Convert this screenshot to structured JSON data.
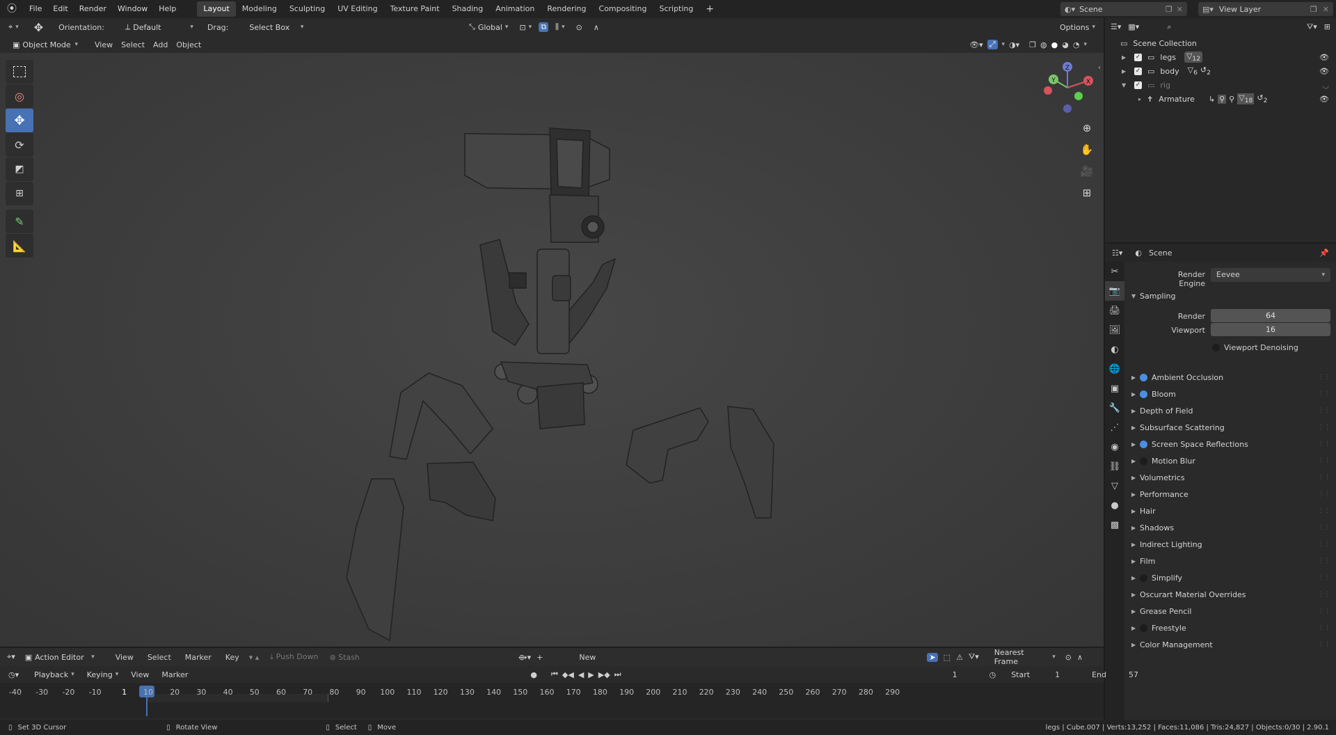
{
  "topbar": {
    "menus": [
      "File",
      "Edit",
      "Render",
      "Window",
      "Help"
    ],
    "workspaces": [
      "Layout",
      "Modeling",
      "Sculpting",
      "UV Editing",
      "Texture Paint",
      "Shading",
      "Animation",
      "Rendering",
      "Compositing",
      "Scripting"
    ],
    "add": "+",
    "scene": "Scene",
    "view_layer": "View Layer"
  },
  "header": {
    "orientation_label": "Orientation:",
    "orientation_value": "Default",
    "drag_label": "Drag:",
    "drag_value": "Select Box",
    "transform_orientation": "Global",
    "options": "Options"
  },
  "vp_menu": {
    "mode": "Object Mode",
    "items": [
      "View",
      "Select",
      "Add",
      "Object"
    ]
  },
  "gizmo": {
    "z": "Z",
    "y": "Y",
    "x": "X"
  },
  "outliner": {
    "root": "Scene Collection",
    "rows": [
      {
        "name": "legs",
        "badge": "12"
      },
      {
        "name": "body",
        "badge": "6",
        "badge2": "2"
      },
      {
        "name": "rig",
        "badge": ""
      },
      {
        "name": "Armature",
        "badge": "18",
        "badge2": "2"
      }
    ]
  },
  "properties": {
    "context": "Scene",
    "engine_label": "Render Engine",
    "engine_value": "Eevee",
    "sampling": {
      "title": "Sampling",
      "render_label": "Render",
      "render_value": "64",
      "viewport_label": "Viewport",
      "viewport_value": "16",
      "denoise": "Viewport Denoising"
    },
    "panels": [
      {
        "label": "Ambient Occlusion",
        "check": "on"
      },
      {
        "label": "Bloom",
        "check": "on"
      },
      {
        "label": "Depth of Field",
        "check": "none"
      },
      {
        "label": "Subsurface Scattering",
        "check": "none"
      },
      {
        "label": "Screen Space Reflections",
        "check": "on"
      },
      {
        "label": "Motion Blur",
        "check": "off"
      },
      {
        "label": "Volumetrics",
        "check": "none"
      },
      {
        "label": "Performance",
        "check": "none"
      },
      {
        "label": "Hair",
        "check": "none"
      },
      {
        "label": "Shadows",
        "check": "none"
      },
      {
        "label": "Indirect Lighting",
        "check": "none"
      },
      {
        "label": "Film",
        "check": "none"
      },
      {
        "label": "Simplify",
        "check": "off"
      },
      {
        "label": "Oscurart Material Overrides",
        "check": "none"
      },
      {
        "label": "Grease Pencil",
        "check": "none"
      },
      {
        "label": "Freestyle",
        "check": "off"
      },
      {
        "label": "Color Management",
        "check": "none"
      }
    ]
  },
  "action_editor": {
    "mode": "Action Editor",
    "menus": [
      "View",
      "Select",
      "Marker",
      "Key"
    ],
    "push_down": "Push Down",
    "stash": "Stash",
    "new": "New",
    "snap": "Nearest Frame"
  },
  "timeline": {
    "menus": [
      "Playback",
      "Keying",
      "View",
      "Marker"
    ],
    "current_frame": "1",
    "start_label": "Start",
    "start_value": "1",
    "end_label": "End",
    "end_value": "57",
    "ticks": [
      "-40",
      "-30",
      "-20",
      "-10",
      "1",
      "10",
      "20",
      "30",
      "40",
      "50",
      "60",
      "70",
      "80",
      "90",
      "100",
      "110",
      "120",
      "130",
      "140",
      "150",
      "160",
      "170",
      "180",
      "190",
      "200",
      "210",
      "220",
      "230",
      "240",
      "250",
      "260",
      "270",
      "280",
      "290"
    ]
  },
  "statusbar": {
    "left1": "Set 3D Cursor",
    "left2": "Rotate View",
    "left3": "Select",
    "left4": "Move",
    "stats": "legs | Cube.007 | Verts:13,252 | Faces:11,086 | Tris:24,827 | Objects:0/30 | 2.90.1"
  },
  "colors": {
    "accent": "#4772b3",
    "checkbox_on": "#4a8fe0"
  }
}
